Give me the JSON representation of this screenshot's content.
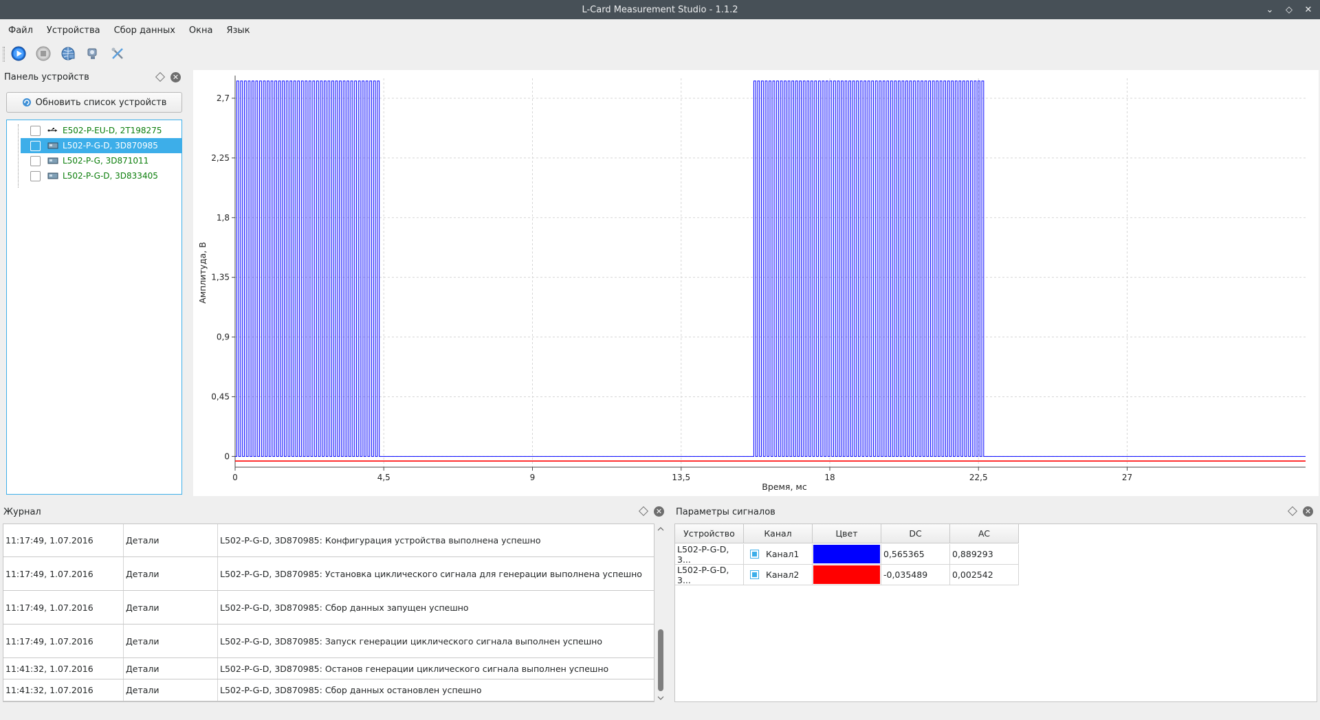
{
  "window": {
    "title": "L-Card Measurement Studio - 1.1.2"
  },
  "menu": [
    "Файл",
    "Устройства",
    "Сбор данных",
    "Окна",
    "Язык"
  ],
  "toolbar": {
    "icons": [
      "play-icon",
      "stop-icon",
      "network-icon",
      "settings-icon",
      "tools-icon"
    ]
  },
  "devices_panel": {
    "title": "Панель устройств",
    "refresh_label": "Обновить список устройств",
    "devices": [
      {
        "label": "E502-P-EU-D, 2T198275",
        "icon": "usb-icon",
        "selected": false
      },
      {
        "label": "L502-P-G-D, 3D870985",
        "icon": "pci-card-icon",
        "selected": true
      },
      {
        "label": "L502-P-G, 3D871011",
        "icon": "pci-card-icon",
        "selected": false
      },
      {
        "label": "L502-P-G-D, 3D833405",
        "icon": "pci-card-icon",
        "selected": false
      }
    ]
  },
  "chart_data": {
    "type": "line",
    "title": "",
    "xlabel": "Время, мс",
    "ylabel": "Амплитуда, В",
    "xlim": [
      0,
      32.4
    ],
    "ylim": [
      -0.05,
      2.85
    ],
    "xticks": [
      "0",
      "4,5",
      "9",
      "13,5",
      "18",
      "22,5",
      "27"
    ],
    "yticks": [
      "0",
      "0,45",
      "0,9",
      "1,35",
      "1,8",
      "2,25",
      "2,7"
    ],
    "grid": true,
    "series": [
      {
        "name": "Канал1",
        "color": "#0000ff",
        "bursts": [
          {
            "x_start": 0.05,
            "x_end": 4.4,
            "period": 0.115,
            "high": 2.83,
            "low": 0.0
          },
          {
            "x_start": 15.7,
            "x_end": 22.7,
            "period": 0.115,
            "high": 2.83,
            "low": 0.0
          }
        ],
        "baseline": 0.0
      },
      {
        "name": "Канал2",
        "color": "#ff0000",
        "baseline": -0.035
      }
    ]
  },
  "journal": {
    "title": "Журнал",
    "rows": [
      {
        "time": "11:17:49, 1.07.2016",
        "level": "Детали",
        "message": "L502-P-G-D, 3D870985: Конфигурация устройства выполнена успешно"
      },
      {
        "time": "11:17:49, 1.07.2016",
        "level": "Детали",
        "message": "L502-P-G-D, 3D870985: Установка циклического сигнала для генерации выполнена успешно"
      },
      {
        "time": "11:17:49, 1.07.2016",
        "level": "Детали",
        "message": "L502-P-G-D, 3D870985: Сбор данных запущен успешно"
      },
      {
        "time": "11:17:49, 1.07.2016",
        "level": "Детали",
        "message": "L502-P-G-D, 3D870985: Запуск генерации циклического сигнала выполнен успешно"
      },
      {
        "time": "11:41:32, 1.07.2016",
        "level": "Детали",
        "message": "L502-P-G-D, 3D870985: Останов генерации циклического сигнала выполнен успешно"
      },
      {
        "time": "11:41:32, 1.07.2016",
        "level": "Детали",
        "message": "L502-P-G-D, 3D870985: Сбор данных остановлен успешно"
      }
    ]
  },
  "signal_params": {
    "title": "Параметры сигналов",
    "headers": [
      "Устройство",
      "Канал",
      "Цвет",
      "DC",
      "AC"
    ],
    "rows": [
      {
        "device": "L502-P-G-D, 3...",
        "channel": "Канал1",
        "color": "#0000ff",
        "dc": "0,565365",
        "ac": "0,889293"
      },
      {
        "device": "L502-P-G-D, 3...",
        "channel": "Канал2",
        "color": "#ff0000",
        "dc": "-0,035489",
        "ac": "0,002542"
      }
    ]
  }
}
